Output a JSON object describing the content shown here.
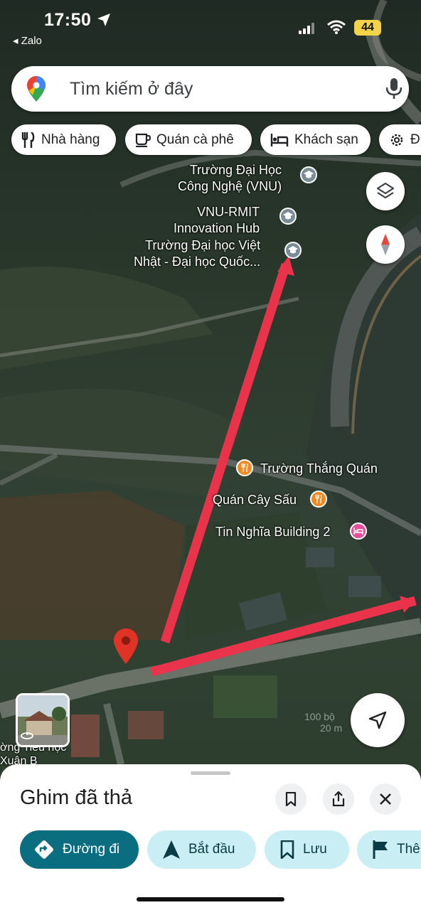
{
  "status": {
    "time": "17:50",
    "back_app": "◂ Zalo",
    "battery": "44"
  },
  "search": {
    "placeholder": "Tìm kiếm ở đây"
  },
  "chips": [
    {
      "label": "Nhà hàng",
      "icon": "utensils-icon"
    },
    {
      "label": "Quán cà phê",
      "icon": "coffee-cup-icon"
    },
    {
      "label": "Khách sạn",
      "icon": "bed-icon"
    },
    {
      "label": "Đ",
      "icon": "gear-icon"
    }
  ],
  "map": {
    "places": [
      {
        "name_line1": "Trường Đại Học",
        "name_line2": "Công Nghệ (VNU)",
        "type": "school"
      },
      {
        "name_line1": "VNU-RMIT",
        "name_line2": "Innovation Hub",
        "type": "school"
      },
      {
        "name_line1": "Trường Đại học Việt",
        "name_line2": "Nhật - Đại học Quốc...",
        "type": "school"
      },
      {
        "name_line1": "Trường Thắng Quán",
        "type": "restaurant"
      },
      {
        "name_line1": "Quán Cây Sấu",
        "type": "restaurant"
      },
      {
        "name_line1": "Tin Nghĩa Building 2",
        "type": "hotel"
      }
    ],
    "partial_label_line1": "ờng Tiểu học",
    "partial_label_line2": "Xuân B",
    "scale_ft": "100 bộ",
    "scale_m": "20 m",
    "colors": {
      "arrow": "#e8334a",
      "pin": "#e03325",
      "school_poi": "#7a8d97",
      "food_poi": "#f08a24",
      "hotel_poi": "#e54e9a"
    }
  },
  "sheet": {
    "title": "Ghim đã thả",
    "actions": [
      {
        "label": "Đường đi",
        "icon": "directions-icon",
        "primary": true
      },
      {
        "label": "Bắt đầu",
        "icon": "navigation-arrow-icon"
      },
      {
        "label": "Lưu",
        "icon": "bookmark-icon"
      },
      {
        "label": "Thê",
        "icon": "flag-icon"
      }
    ]
  },
  "accent": "#0b6e80"
}
